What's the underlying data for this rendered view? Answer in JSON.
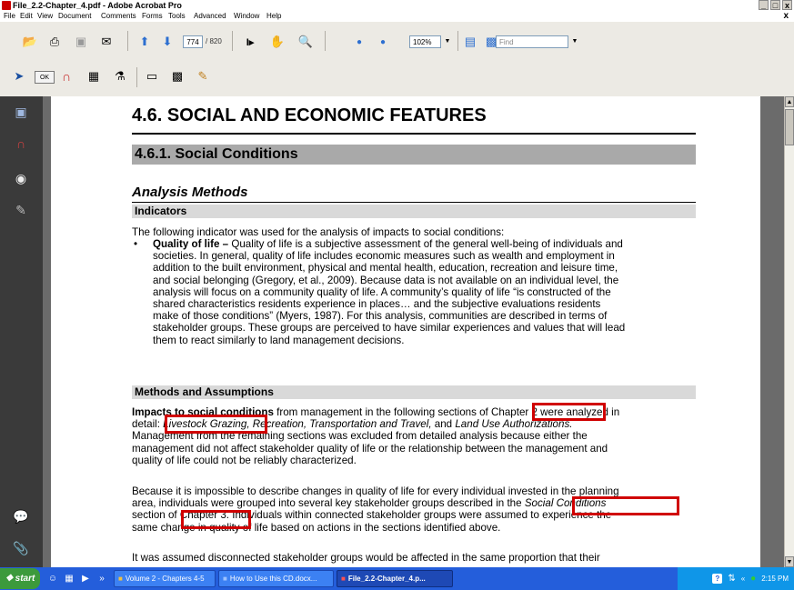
{
  "window": {
    "title": "File_2.2-Chapter_4.pdf - Adobe Acrobat Pro",
    "controls": [
      "_",
      "□",
      "x"
    ]
  },
  "menubar": {
    "items": [
      "File",
      "Edit",
      "View",
      "Document",
      "Comments",
      "Forms",
      "Tools",
      "Advanced",
      "Window",
      "Help"
    ],
    "close": "x"
  },
  "toolbar": {
    "page_current": "774",
    "page_total": "/ 820",
    "zoom": "102%",
    "find_placeholder": "Find",
    "icons": [
      "open-icon",
      "print-icon",
      "save-icon",
      "email-icon",
      "previous-page-icon",
      "next-page-icon",
      "select-tool-icon",
      "hand-tool-icon",
      "zoom-tool-icon",
      "zoom-out-icon",
      "zoom-in-icon",
      "single-page-icon",
      "fit-page-icon"
    ]
  },
  "toolbar2": {
    "ok_label": "OK"
  },
  "document": {
    "h1": "4.6. SOCIAL AND ECONOMIC FEATURES",
    "h2": "4.6.1. Social Conditions",
    "h3": "Analysis Methods",
    "indicators_heading": "Indicators",
    "indicators_intro": "The following indicator was used for the analysis of impacts to social conditions:",
    "bullet_label": "Quality of life –",
    "bullet_lines": [
      "Quality of life is a subjective assessment of the general well-being of individuals and",
      "societies. In general, quality of life includes economic measures such as wealth and employment in",
      "addition to the built environment, physical and mental health, education, recreation and leisure time,",
      "and social belonging (Gregory, et al., 2009). Because data is not available on an individual level, the",
      "analysis will focus on a community quality of life. A community’s quality of life “is constructed of the",
      "shared characteristics residents experience in places… and the subjective evaluations residents",
      "make of those conditions” (Myers, 1987). For this analysis, communities are described in terms of",
      "stakeholder groups. These groups are perceived to have similar experiences and values that will lead",
      "them to react similarly to land management decisions."
    ],
    "methods_heading": "Methods and Assumptions",
    "p1": {
      "bold_lead": "Impacts to social conditions",
      "l1_rest": "from management in the following sections of",
      "chapter2": "Chapter 2",
      "l1_end": "were analyzed in",
      "l2_start": "detail:",
      "livestock": "Livestock Grazing,",
      "l2_mid": "Recreation, Transportation and Travel,",
      "l2_and": "and",
      "land_use": "Land Use Authorizations.",
      "lines": [
        "Management from the remaining sections was excluded from detailed analysis because either the",
        "management did not affect stakeholder quality of life or the relationship between the management and",
        "quality of life could not be reliably characterized."
      ]
    },
    "p2": {
      "l1": "Because it is impossible to describe changes in quality of life for every individual invested in the planning",
      "l2_start": "area, individuals were grouped into several key stakeholder groups described in the",
      "social_conditions": "Social Conditions",
      "l3_start": "section of",
      "chapter3": "Chapter 3.",
      "l3_rest": "Individuals within connected stakeholder groups were assumed to experience the",
      "l4": "same change in quality of life based on actions in the sections identified above."
    },
    "p3": {
      "l1": "It was assumed disconnected stakeholder groups would be affected in the same proportion that their"
    }
  },
  "taskbar": {
    "start": "start",
    "overflow": "»",
    "tasks": [
      "Volume 2 - Chapters 4-5",
      "How to Use this CD.docx...",
      "File_2.2-Chapter_4.p..."
    ],
    "tray_collapse": "«",
    "clock": "2:15 PM"
  }
}
